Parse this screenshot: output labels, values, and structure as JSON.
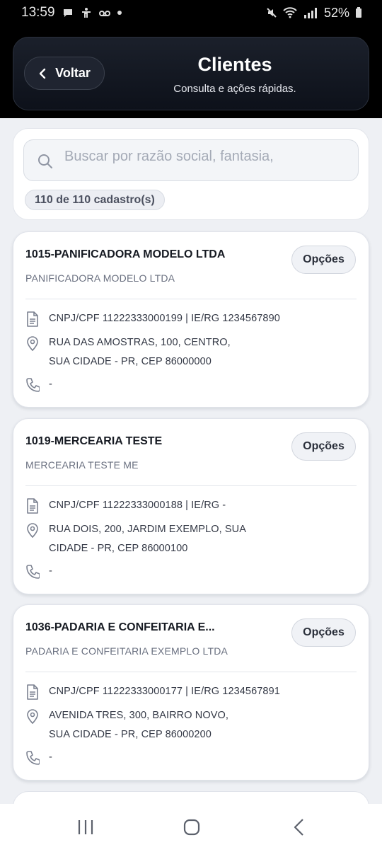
{
  "status_bar": {
    "time": "13:59",
    "battery": "52%"
  },
  "header": {
    "back_label": "Voltar",
    "title": "Clientes",
    "subtitle": "Consulta e ações rápidas."
  },
  "search": {
    "placeholder": "Buscar por razão social, fantasia,",
    "count_label": "110 de 110 cadastro(s)"
  },
  "options_label": "Opções",
  "clients": [
    {
      "title": "1015-PANIFICADORA MODELO LTDA",
      "subtitle": "PANIFICADORA MODELO LTDA",
      "doc": "CNPJ/CPF 11222333000199 | IE/RG 1234567890",
      "address_line1": "RUA DAS AMOSTRAS, 100, CENTRO,",
      "address_line2": "SUA CIDADE - PR, CEP 86000000",
      "phone": "-"
    },
    {
      "title": "1019-MERCEARIA TESTE",
      "subtitle": "MERCEARIA TESTE ME",
      "doc": "CNPJ/CPF 11222333000188 | IE/RG -",
      "address_line1": "RUA DOIS, 200, JARDIM EXEMPLO, SUA",
      "address_line2": "CIDADE - PR, CEP 86000100",
      "phone": "-"
    },
    {
      "title": "1036-PADARIA E CONFEITARIA E...",
      "subtitle": "PADARIA E CONFEITARIA EXEMPLO LTDA",
      "doc": "CNPJ/CPF 11222333000177 | IE/RG 1234567891",
      "address_line1": "AVENIDA TRES, 300, BAIRRO NOVO,",
      "address_line2": "SUA CIDADE - PR, CEP 86000200",
      "phone": "-"
    }
  ],
  "icons": {
    "document": "document-icon",
    "location": "location-pin-icon",
    "phone": "phone-icon",
    "search": "search-icon",
    "back": "chevron-left-icon"
  },
  "colors": {
    "header_bg": "#0d111a",
    "page_bg": "#eef0f4",
    "card_bg": "#ffffff"
  }
}
